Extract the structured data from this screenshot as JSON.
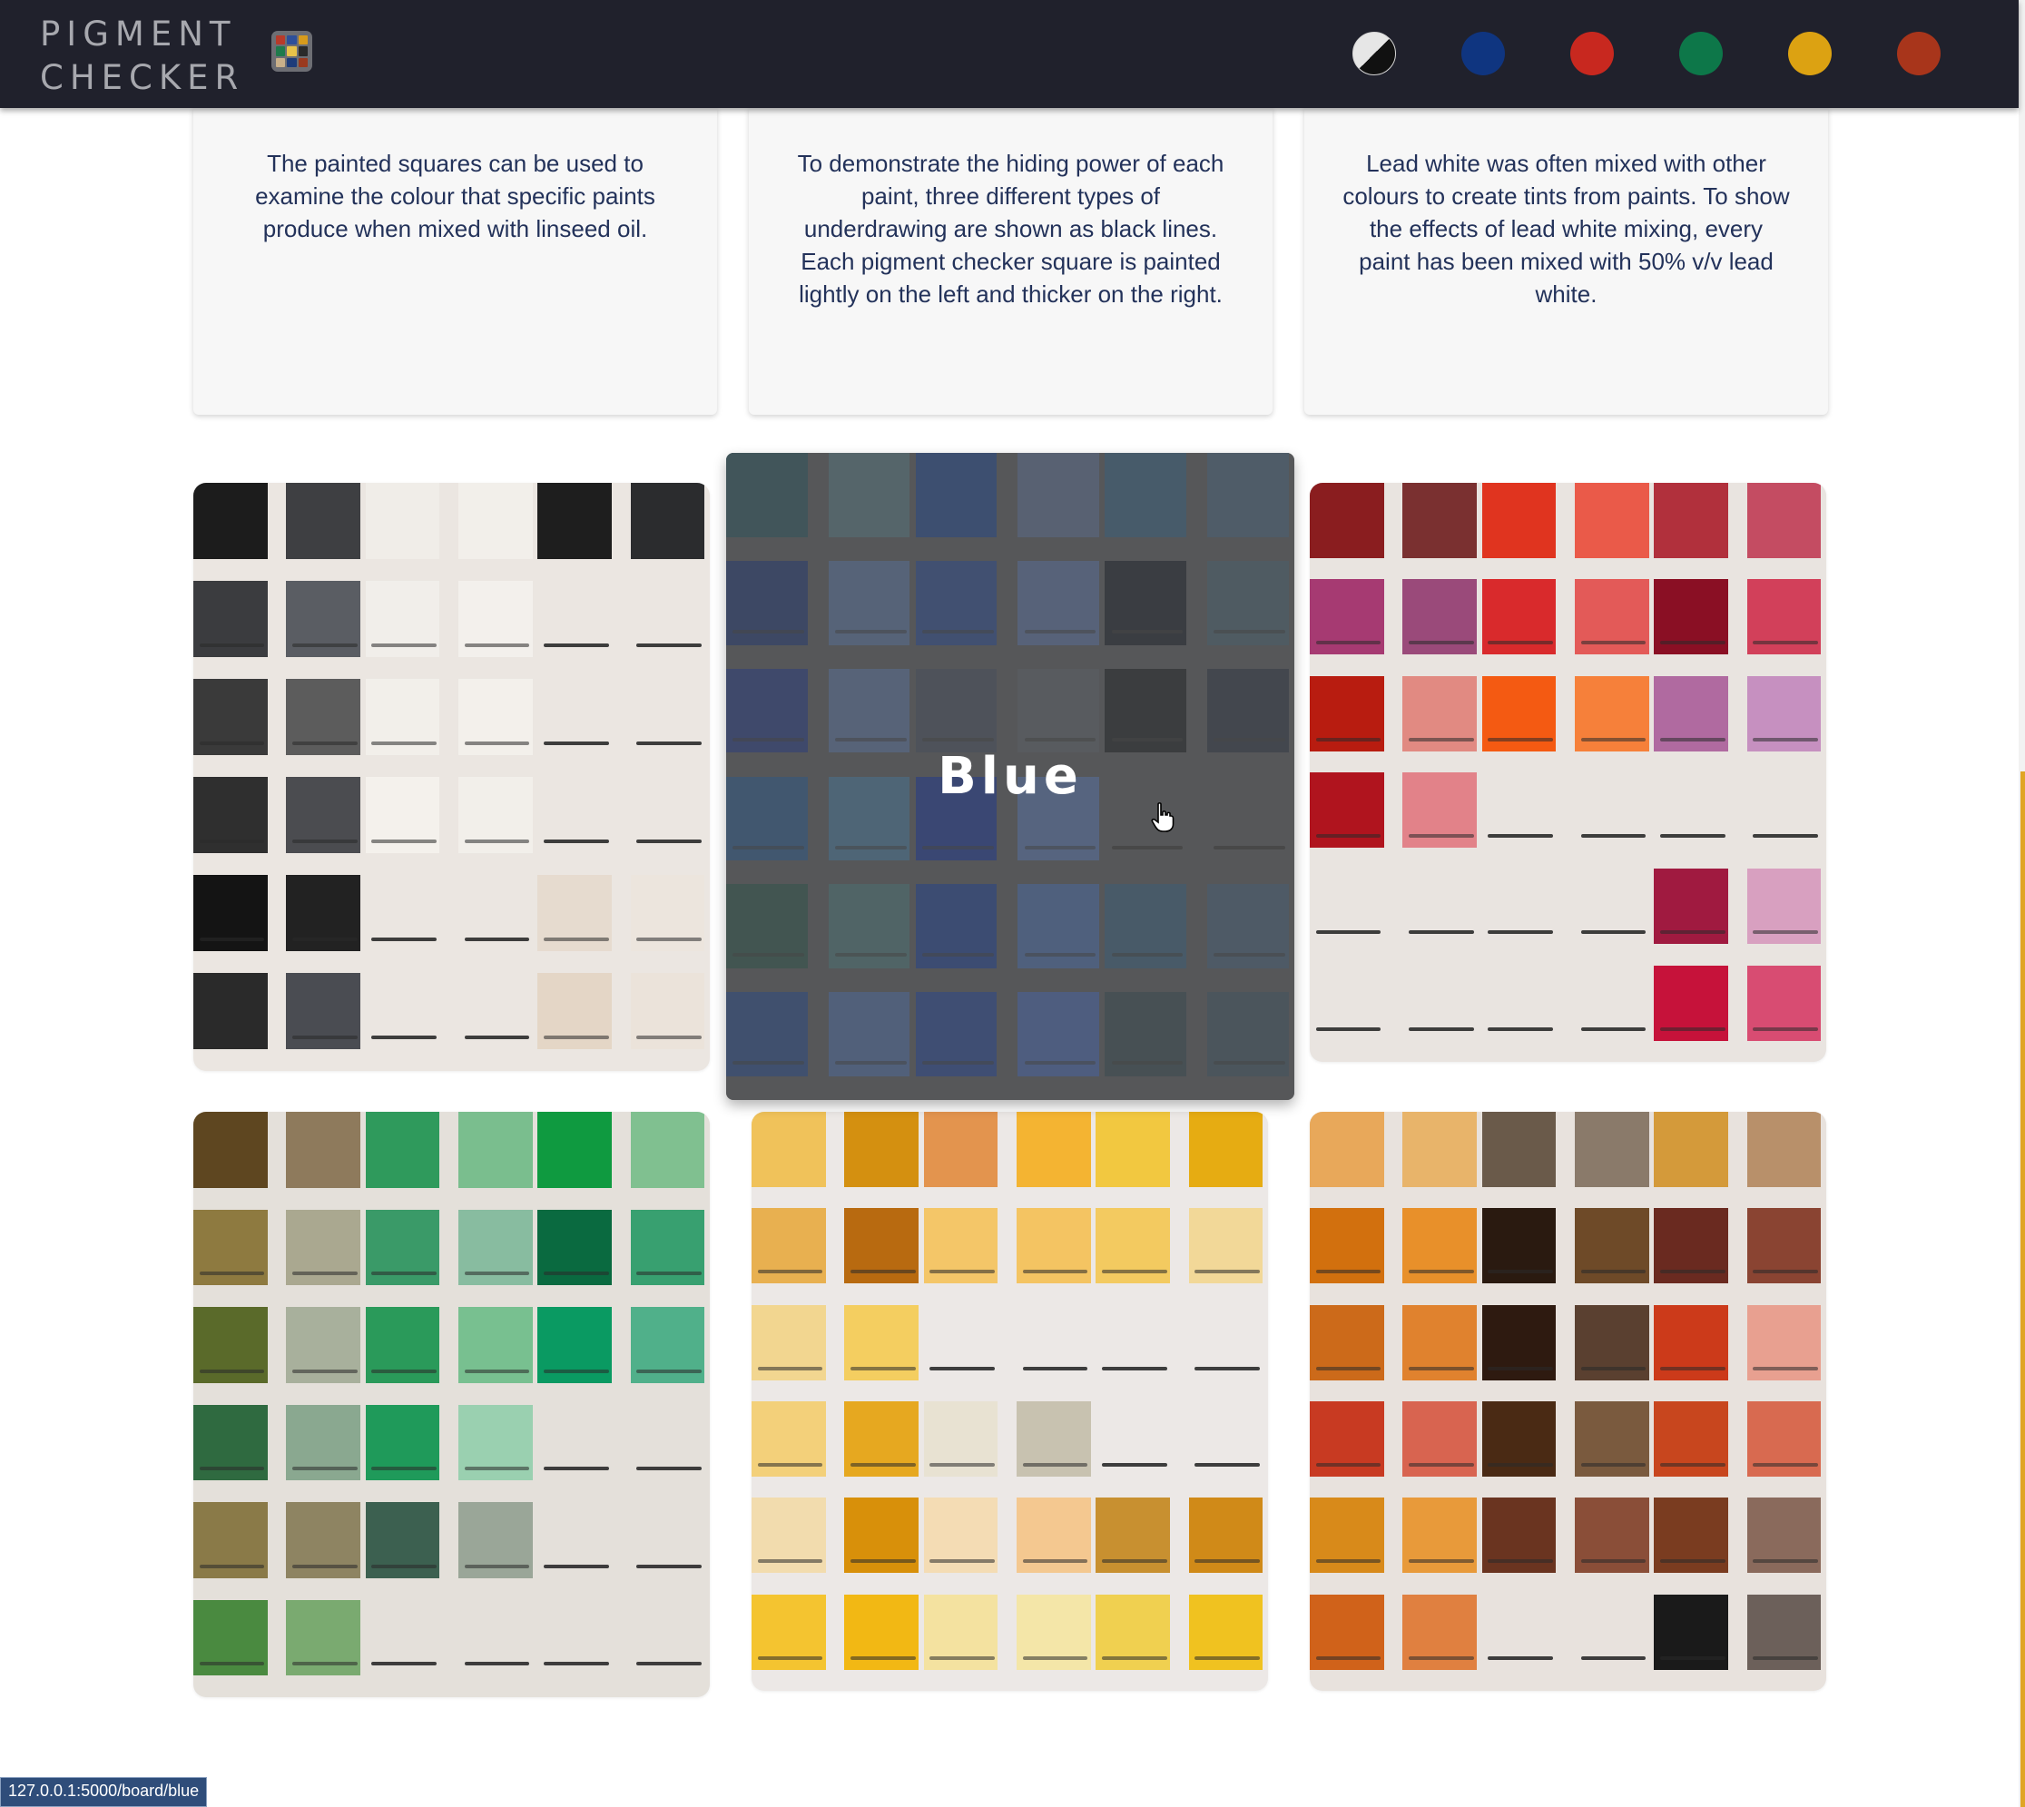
{
  "app": {
    "logo_line1": "PIGMENT",
    "logo_line2": "CHECKER"
  },
  "nav": {
    "colour_dots": [
      {
        "name": "black-white",
        "color": "split #e6e6e6 / #111111"
      },
      {
        "name": "blue",
        "color": "#0f3580"
      },
      {
        "name": "red",
        "color": "#c8281f"
      },
      {
        "name": "green",
        "color": "#0d7749"
      },
      {
        "name": "yellow",
        "color": "#dca212"
      },
      {
        "name": "brown",
        "color": "#a8351b"
      }
    ]
  },
  "info_cards": [
    {
      "text": "The painted squares can be used to examine the colour that specific paints produce when mixed with linseed oil."
    },
    {
      "text": "To demonstrate the hiding power of each paint, three different types of underdrawing are shown as black lines. Each pigment checker square is painted lightly on the left and thicker on the right."
    },
    {
      "text": "Lead white was often mixed with other colours to create tints from paints. To show the effects of lead white mixing, every paint has been mixed with 50% v/v lead white."
    }
  ],
  "boards": [
    {
      "name": "black-white",
      "hovered": false
    },
    {
      "name": "blue",
      "hovered": true,
      "overlay_label": "Blue"
    },
    {
      "name": "red",
      "hovered": false
    },
    {
      "name": "green",
      "hovered": false
    },
    {
      "name": "yellow",
      "hovered": false
    },
    {
      "name": "brown",
      "hovered": false
    }
  ],
  "status_bar": {
    "url": "127.0.0.1:5000/board/blue"
  },
  "colors": {
    "header_bg": "#20212c",
    "text": "#23325a",
    "card_bg": "#f7f7f7",
    "scroll_accent": "#e0a524"
  }
}
